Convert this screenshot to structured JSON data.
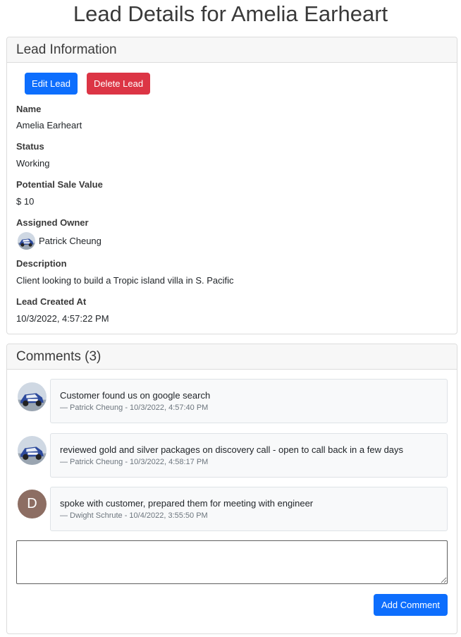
{
  "page": {
    "title": "Lead Details for Amelia Earheart"
  },
  "lead_card": {
    "header": "Lead Information",
    "edit_label": "Edit Lead",
    "delete_label": "Delete Lead",
    "fields": {
      "name_label": "Name",
      "name_value": "Amelia Earheart",
      "status_label": "Status",
      "status_value": "Working",
      "sale_label": "Potential Sale Value",
      "sale_value": "$ 10",
      "owner_label": "Assigned Owner",
      "owner_value": "Patrick Cheung",
      "owner_avatar_icon": "car-avatar-icon",
      "description_label": "Description",
      "description_value": "Client looking to build a Tropic island villa in S. Pacific",
      "created_label": "Lead Created At",
      "created_value": "10/3/2022, 4:57:22 PM"
    }
  },
  "comments_card": {
    "header": "Comments (3)",
    "comments": [
      {
        "text": "Customer found us on google search",
        "meta": "— Patrick Cheung - 10/3/2022, 4:57:40 PM",
        "avatar_icon": "car-avatar-icon"
      },
      {
        "text": "reviewed gold and silver packages on discovery call - open to call back in a few days",
        "meta": "— Patrick Cheung - 10/3/2022, 4:58:17 PM",
        "avatar_icon": "car-avatar-icon"
      },
      {
        "text": "spoke with customer, prepared them for meeting with engineer",
        "meta": "— Dwight Schrute - 10/4/2022, 3:55:50 PM",
        "avatar_letter": "D",
        "avatar_color": "#8d6e63"
      }
    ],
    "textarea_value": "",
    "add_label": "Add Comment"
  },
  "colors": {
    "primary": "#0d6efd",
    "danger": "#dc3545"
  }
}
